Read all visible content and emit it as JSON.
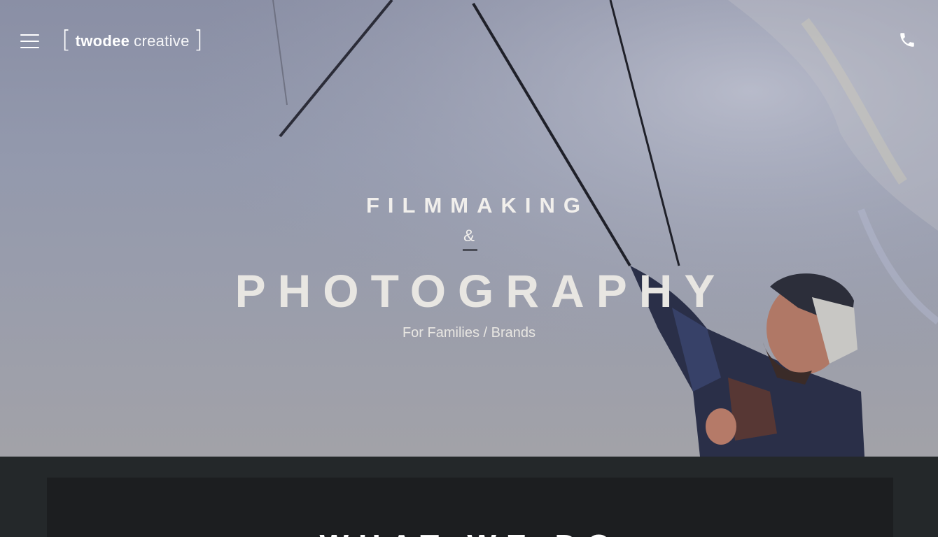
{
  "brand": {
    "logo_bold": "twodee",
    "logo_light": "creative",
    "bracket_open": "[",
    "bracket_close": "]"
  },
  "nav": {
    "menu_icon": "hamburger-menu-icon",
    "phone_icon": "phone-icon"
  },
  "hero": {
    "line1": "FILMMAKING",
    "line2": "&",
    "line3": "PHOTOGRAPHY",
    "subtitle": "For Families / Brands"
  },
  "section": {
    "title": "WHAT WE DO"
  },
  "colors": {
    "hero_overlay": "#9399ad",
    "text_light": "#f1efec",
    "page_bg": "#24282a",
    "card_bg": "#1c1e20",
    "accent_underline": "#4a4c56"
  }
}
